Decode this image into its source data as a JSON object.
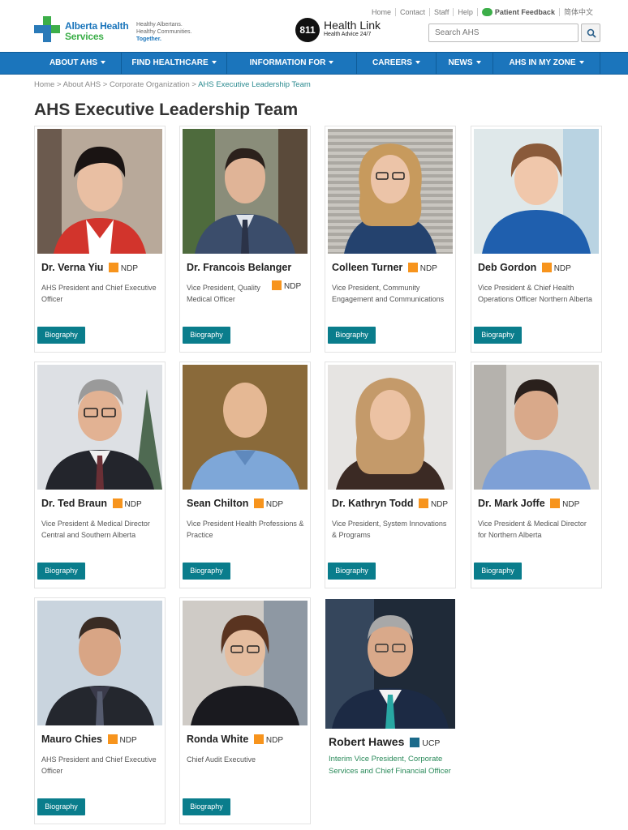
{
  "header": {
    "logo_line1": "Alberta Health",
    "logo_line2": "Services",
    "tagline1": "Healthy Albertans.",
    "tagline2": "Healthy Communities.",
    "tagline3": "Together.",
    "healthlink_number": "811",
    "healthlink_title": "Health Link",
    "healthlink_sub": "Health Advice 24/7",
    "top_links": [
      "Home",
      "Contact",
      "Staff",
      "Help"
    ],
    "feedback": "Patient Feedback",
    "language": "简体中文",
    "search_placeholder": "Search AHS"
  },
  "nav": {
    "items": [
      "ABOUT AHS",
      "FIND HEALTHCARE",
      "INFORMATION FOR",
      "CAREERS",
      "NEWS",
      "AHS IN MY ZONE"
    ]
  },
  "breadcrumb": {
    "home": "Home",
    "about": "About AHS",
    "org": "Corporate Organization",
    "current": "AHS Executive Leadership Team",
    "sep": ">"
  },
  "page_title": "AHS Executive Leadership Team",
  "colors": {
    "ndp": "#f7941d",
    "ucp": "#1b6a8a",
    "accent": "#0a7d8c",
    "nav": "#1b75bc"
  },
  "button_label": "Biography",
  "people": [
    {
      "name": "Dr. Verna Yiu",
      "party": "NDP",
      "title": "AHS President and Chief Executive Officer"
    },
    {
      "name": "Dr. Francois Belanger",
      "party": "NDP",
      "title": "Vice President, Quality Medical Officer"
    },
    {
      "name": "Colleen Turner",
      "party": "NDP",
      "title": "Vice President, Community Engagement and Communications"
    },
    {
      "name": "Deb Gordon",
      "party": "NDP",
      "title": "Vice President & Chief Health Operations Officer Northern Alberta"
    },
    {
      "name": "Dr. Ted Braun",
      "party": "NDP",
      "title": "Vice President & Medical Director Central and Southern Alberta"
    },
    {
      "name": "Sean Chilton",
      "party": "NDP",
      "title": "Vice President Health Professions & Practice"
    },
    {
      "name": "Dr. Kathryn Todd",
      "party": "NDP",
      "title": "Vice President, System Innovations & Programs"
    },
    {
      "name": "Dr. Mark Joffe",
      "party": "NDP",
      "title": "Vice President & Medical Director for Northern Alberta"
    },
    {
      "name": "Mauro Chies",
      "party": "NDP",
      "title": "AHS President and Chief Executive Officer"
    },
    {
      "name": "Ronda White",
      "party": "NDP",
      "title": "Chief Audit Executive"
    },
    {
      "name": "Robert Hawes",
      "party": "UCP",
      "title": "Interim Vice President, Corporate Services and Chief Financial Officer"
    }
  ]
}
